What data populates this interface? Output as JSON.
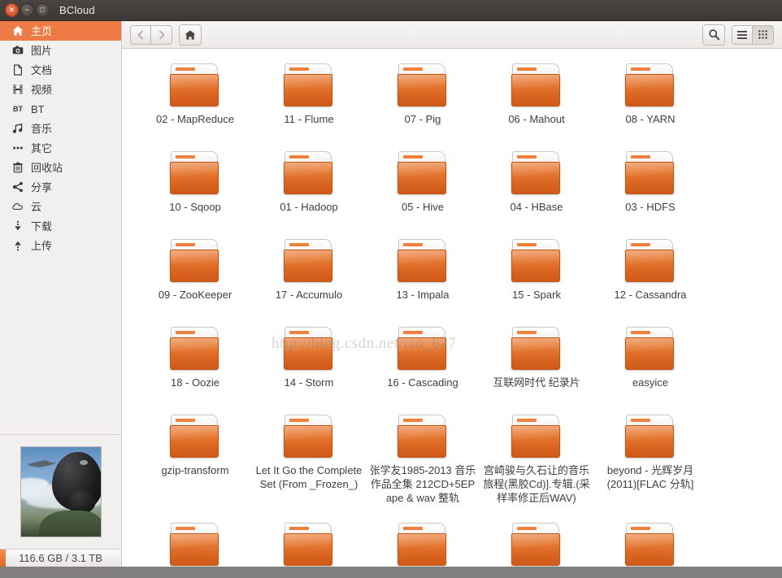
{
  "window": {
    "title": "BCloud",
    "controls": [
      {
        "name": "close",
        "glyph": "✕"
      },
      {
        "name": "minimize",
        "glyph": "−"
      },
      {
        "name": "maximize",
        "glyph": "□"
      }
    ]
  },
  "colors": {
    "accent": "#ee7a45",
    "folder_orange": "#e3742f",
    "titlebar": "#3b3836",
    "sidebar_bg": "#f2f0ee"
  },
  "sidebar": {
    "items": [
      {
        "label": "主页",
        "icon": "home-icon",
        "active": true
      },
      {
        "label": "图片",
        "icon": "camera-icon",
        "active": false
      },
      {
        "label": "文档",
        "icon": "document-icon",
        "active": false
      },
      {
        "label": "视频",
        "icon": "film-icon",
        "active": false
      },
      {
        "label": "BT",
        "icon": "bt-icon",
        "active": false
      },
      {
        "label": "音乐",
        "icon": "music-icon",
        "active": false
      },
      {
        "label": "其它",
        "icon": "ellipsis-icon",
        "active": false
      },
      {
        "label": "回收站",
        "icon": "trash-icon",
        "active": false
      },
      {
        "label": "分享",
        "icon": "share-icon",
        "active": false
      },
      {
        "label": "云",
        "icon": "cloud-icon",
        "active": false
      },
      {
        "label": "下载",
        "icon": "download-icon",
        "active": false
      },
      {
        "label": "上传",
        "icon": "upload-icon",
        "active": false
      }
    ],
    "storage": {
      "text": "116.6 GB / 3.1 TB",
      "used": "116.6 GB",
      "total": "3.1 TB"
    },
    "photo_alt": "fighter-pilot-photo"
  },
  "toolbar": {
    "back": {
      "icon": "chevron-left-icon",
      "label": "Back",
      "enabled": false
    },
    "forward": {
      "icon": "chevron-right-icon",
      "label": "Forward",
      "enabled": false
    },
    "home": {
      "icon": "home-icon",
      "label": "Home"
    },
    "search": {
      "icon": "search-icon",
      "label": "Search"
    },
    "list_view": {
      "icon": "list-view-icon",
      "label": "List view",
      "selected": false
    },
    "grid_view": {
      "icon": "grid-view-icon",
      "label": "Grid view",
      "selected": true
    }
  },
  "watermark": "http://blog.csdn.net/tao_627",
  "files": [
    {
      "name": "02 - MapReduce",
      "type": "folder"
    },
    {
      "name": "11 - Flume",
      "type": "folder"
    },
    {
      "name": "07 - Pig",
      "type": "folder"
    },
    {
      "name": "06 - Mahout",
      "type": "folder"
    },
    {
      "name": "08 - YARN",
      "type": "folder"
    },
    {
      "name": "10 - Sqoop",
      "type": "folder"
    },
    {
      "name": "01 - Hadoop",
      "type": "folder"
    },
    {
      "name": "05 - Hive",
      "type": "folder"
    },
    {
      "name": "04 - HBase",
      "type": "folder"
    },
    {
      "name": "03 - HDFS",
      "type": "folder"
    },
    {
      "name": "09 - ZooKeeper",
      "type": "folder"
    },
    {
      "name": "17 - Accumulo",
      "type": "folder"
    },
    {
      "name": "13 - Impala",
      "type": "folder"
    },
    {
      "name": "15 - Spark",
      "type": "folder"
    },
    {
      "name": "12 - Cassandra",
      "type": "folder"
    },
    {
      "name": "18 - Oozie",
      "type": "folder"
    },
    {
      "name": "14 - Storm",
      "type": "folder"
    },
    {
      "name": "16 - Cascading",
      "type": "folder"
    },
    {
      "name": "互联网时代 纪录片",
      "type": "folder"
    },
    {
      "name": "easyice",
      "type": "folder"
    },
    {
      "name": "gzip-transform",
      "type": "folder"
    },
    {
      "name": "Let It Go the Complete Set (From _Frozen_)",
      "type": "folder"
    },
    {
      "name": "张学友1985-2013 音乐作品全集 212CD+5EP ape & wav 整轨",
      "type": "folder"
    },
    {
      "name": "宫崎骏与久石让的音乐旅程(黑胶Cd)].专辑.(采样率修正后WAV)",
      "type": "folder"
    },
    {
      "name": "beyond - 光辉岁月(2011)[FLAC 分轨]",
      "type": "folder"
    }
  ],
  "partial_row_count": 5
}
